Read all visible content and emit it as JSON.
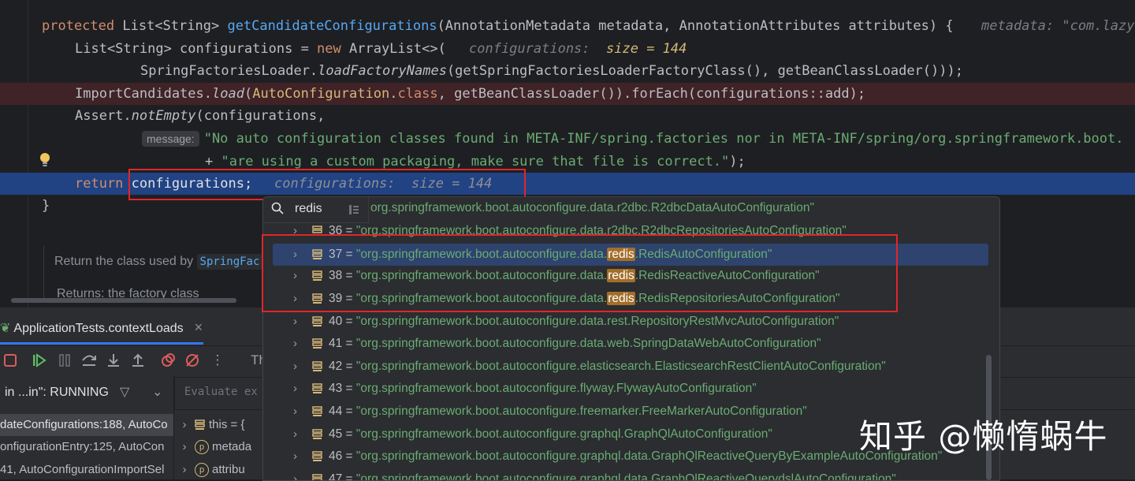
{
  "editor": {
    "lines": {
      "l1": {
        "kw": "protected",
        "type": "List<String>",
        "fn": "getCandidateConfigurations",
        "params": "(AnnotationMetadata metadata, AnnotationAttributes attributes) {",
        "hint": "metadata: \"com.lazy"
      },
      "l2": {
        "decl": "List<String> configurations = ",
        "kw": "new",
        "ctor": " ArrayList<>(",
        "hint_name": "configurations:",
        "hint_val": "size = 144"
      },
      "l3": {
        "cls": "SpringFactoriesLoader.",
        "method": "loadFactoryNames",
        "rest": "(getSpringFactoriesLoaderFactoryClass(), getBeanClassLoader()));"
      },
      "l4": {
        "cls": "ImportCandidates.",
        "method": "load",
        "open": "(",
        "ann": "AutoConfiguration",
        "dot": ".",
        "kwclass": "class",
        "rest": ", getBeanClassLoader()).forEach(configurations::add);"
      },
      "l5": {
        "cls": "Assert.",
        "method": "notEmpty",
        "rest": "(configurations,"
      },
      "l6": {
        "badge": "message:",
        "str": "\"No auto configuration classes found in META-INF/spring.factories nor in META-INF/spring/org.springframework.boot."
      },
      "l7": {
        "plus": "+ ",
        "str": "\"are using a custom packaging, make sure that file is correct.\"",
        "rest": ");"
      },
      "l8": {
        "kw": "return",
        "var": "configurations;",
        "hint_name": "configurations:",
        "hint_val": "size = 144"
      },
      "l9": {
        "brace": "}"
      }
    },
    "doc": {
      "text": "Return the class used by",
      "code": "SpringFac",
      "returns": "Returns: the factory class"
    }
  },
  "debug": {
    "tab_label": "ApplicationTests.contextLoads",
    "close": "×",
    "thread_label": "in ...in\": RUNNING",
    "eval_placeholder": "Evaluate ex",
    "toolbar_partial": "Th",
    "frames": [
      "dateConfigurations:188, AutoCo",
      "onfigurationEntry:125, AutoCon",
      "41, AutoConfigurationImportSel"
    ],
    "vars": [
      {
        "name": "this = {",
        "kind": "field"
      },
      {
        "name": "metada",
        "kind": "param"
      },
      {
        "name": "attribu",
        "kind": "param"
      }
    ]
  },
  "popup": {
    "search_text": "redis",
    "partial_top": "org.springframework.boot.autoconfigure.data.r2dbc.R2dbcDataAutoConfiguration\"",
    "rows": [
      {
        "idx": "36",
        "pre": "\"org.springframework.boot.autoconfigure.data.r2dbc.R2dbcRepositoriesAutoConfiguration\"",
        "hl": "",
        "post": ""
      },
      {
        "idx": "37",
        "pre": "\"org.springframework.boot.autoconfigure.data.",
        "hl": "redis",
        "post": ".RedisAutoConfiguration\""
      },
      {
        "idx": "38",
        "pre": "\"org.springframework.boot.autoconfigure.data.",
        "hl": "redis",
        "post": ".RedisReactiveAutoConfiguration\""
      },
      {
        "idx": "39",
        "pre": "\"org.springframework.boot.autoconfigure.data.",
        "hl": "redis",
        "post": ".RedisRepositoriesAutoConfiguration\""
      },
      {
        "idx": "40",
        "pre": "\"org.springframework.boot.autoconfigure.data.rest.RepositoryRestMvcAutoConfiguration\"",
        "hl": "",
        "post": ""
      },
      {
        "idx": "41",
        "pre": "\"org.springframework.boot.autoconfigure.data.web.SpringDataWebAutoConfiguration\"",
        "hl": "",
        "post": ""
      },
      {
        "idx": "42",
        "pre": "\"org.springframework.boot.autoconfigure.elasticsearch.ElasticsearchRestClientAutoConfiguration\"",
        "hl": "",
        "post": ""
      },
      {
        "idx": "43",
        "pre": "\"org.springframework.boot.autoconfigure.flyway.FlywayAutoConfiguration\"",
        "hl": "",
        "post": ""
      },
      {
        "idx": "44",
        "pre": "\"org.springframework.boot.autoconfigure.freemarker.FreeMarkerAutoConfiguration\"",
        "hl": "",
        "post": ""
      },
      {
        "idx": "45",
        "pre": "\"org.springframework.boot.autoconfigure.graphql.GraphQlAutoConfiguration\"",
        "hl": "",
        "post": ""
      },
      {
        "idx": "46",
        "pre": "\"org.springframework.boot.autoconfigure.graphql.data.GraphQlReactiveQueryByExampleAutoConfiguration\"",
        "hl": "",
        "post": ""
      },
      {
        "idx": "47",
        "pre": "\"org.springframework.boot.autoconfigure.graphql.data.GraphQlReactiveQuerydslAutoConfiguration\"",
        "hl": "",
        "post": ""
      }
    ],
    "selected_idx": "37",
    "eq": " = "
  },
  "watermark": "知乎 @懒惰蜗牛",
  "colors": {
    "accent": "#3574f0",
    "highlight_box": "#e0262b",
    "string": "#6aab73",
    "keyword": "#cf8e6d"
  }
}
